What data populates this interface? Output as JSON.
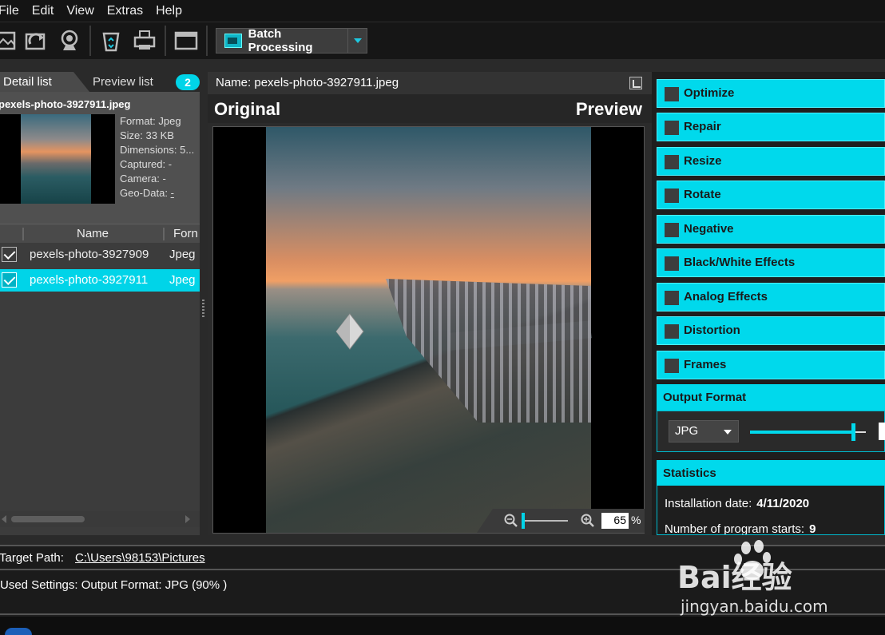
{
  "menu": [
    "File",
    "Edit",
    "View",
    "Extras",
    "Help"
  ],
  "toolbar": {
    "batch_label": "Batch Processing",
    "icons": [
      "open-image-icon",
      "reload-icon",
      "webcam-icon",
      "recycle-bin-icon",
      "printer-icon",
      "window-icon",
      "batch-processing-icon"
    ]
  },
  "left_panel": {
    "tab_detail": "Detail list",
    "tab_preview": "Preview list",
    "badge_count": "2",
    "detail": {
      "filename": "pexels-photo-3927911.jpeg",
      "format": "Format: Jpeg",
      "size": "Size: 33 KB",
      "dimensions": "Dimensions: 5...",
      "captured": "Captured: -",
      "camera": "Camera: -",
      "geo_label": "Geo-Data: ",
      "geo_value": "-"
    },
    "columns": {
      "name": "Name",
      "format": "Forn"
    },
    "rows": [
      {
        "name": "pexels-photo-3927909",
        "format": "Jpeg",
        "checked": true,
        "selected": false
      },
      {
        "name": "pexels-photo-3927911",
        "format": "Jpeg",
        "checked": true,
        "selected": true
      }
    ]
  },
  "center": {
    "name_bar": "Name: pexels-photo-3927911.jpeg",
    "label_original": "Original",
    "label_preview": "Preview",
    "zoom_value": "65",
    "zoom_unit": "%"
  },
  "right_panel": {
    "sections": [
      "Optimize",
      "Repair",
      "Resize",
      "Rotate",
      "Negative",
      "Black/White Effects",
      "Analog Effects",
      "Distortion",
      "Frames"
    ],
    "output_format_title": "Output Format",
    "output_format_value": "JPG",
    "quality_level": 0.9,
    "statistics_title": "Statistics",
    "stats": [
      {
        "label": "Installation date:",
        "value": "4/11/2020"
      },
      {
        "label": "Number of program starts:",
        "value": "9"
      }
    ]
  },
  "bottom": {
    "target_label": "Target Path:",
    "target_path": "C:\\Users\\98153\\Pictures",
    "used_settings": "Used Settings: Output Format: JPG (90% )"
  },
  "colors": {
    "accent": "#00d9ec",
    "bg": "#1e1e1e",
    "panel": "#3c3c3c"
  },
  "watermark": {
    "text": "Bai经验",
    "url": "jingyan.baidu.com"
  }
}
